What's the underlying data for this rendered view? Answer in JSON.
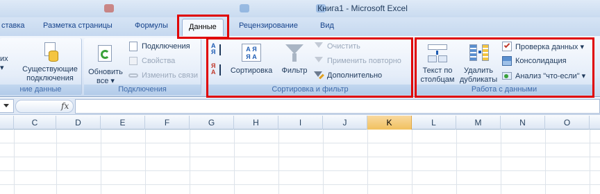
{
  "window": {
    "title": "Книга1 - Microsoft Excel"
  },
  "tabs": [
    {
      "label": "ставка"
    },
    {
      "label": "Разметка страницы"
    },
    {
      "label": "Формулы"
    },
    {
      "label": "Данные",
      "active": true
    },
    {
      "label": "Рецензирование"
    },
    {
      "label": "Вид"
    }
  ],
  "ribbon": {
    "groups": {
      "external": {
        "label": "ние данные",
        "btn_from_line1": "их",
        "btn_from_line2": "▾",
        "existing_line1": "Существующие",
        "existing_line2": "подключения"
      },
      "connections": {
        "label": "Подключения",
        "refresh_line1": "Обновить",
        "refresh_line2": "все ▾",
        "connections": "Подключения",
        "properties": "Свойства",
        "edit_links": "Изменить связи"
      },
      "sort_filter": {
        "label": "Сортировка и фильтр",
        "sort": "Сортировка",
        "filter": "Фильтр",
        "clear": "Очистить",
        "reapply": "Применить повторно",
        "advanced": "Дополнительно"
      },
      "data_tools": {
        "label": "Работа с данными",
        "text_to_cols_line1": "Текст по",
        "text_to_cols_line2": "столбцам",
        "remove_dup_line1": "Удалить",
        "remove_dup_line2": "дубликаты",
        "validation": "Проверка данных ▾",
        "consolidate": "Консолидация",
        "whatif": "Анализ \"что-если\" ▾"
      }
    }
  },
  "formula_bar": {
    "fx_label": "fx",
    "value": ""
  },
  "columns": [
    "C",
    "D",
    "E",
    "F",
    "G",
    "H",
    "I",
    "J",
    "K",
    "L",
    "M",
    "N",
    "O"
  ],
  "selected_column": "K",
  "colors": {
    "highlight_border": "#e00000",
    "selected_col": "#f1c15f",
    "ribbon_blue": "#dfe9f7"
  }
}
